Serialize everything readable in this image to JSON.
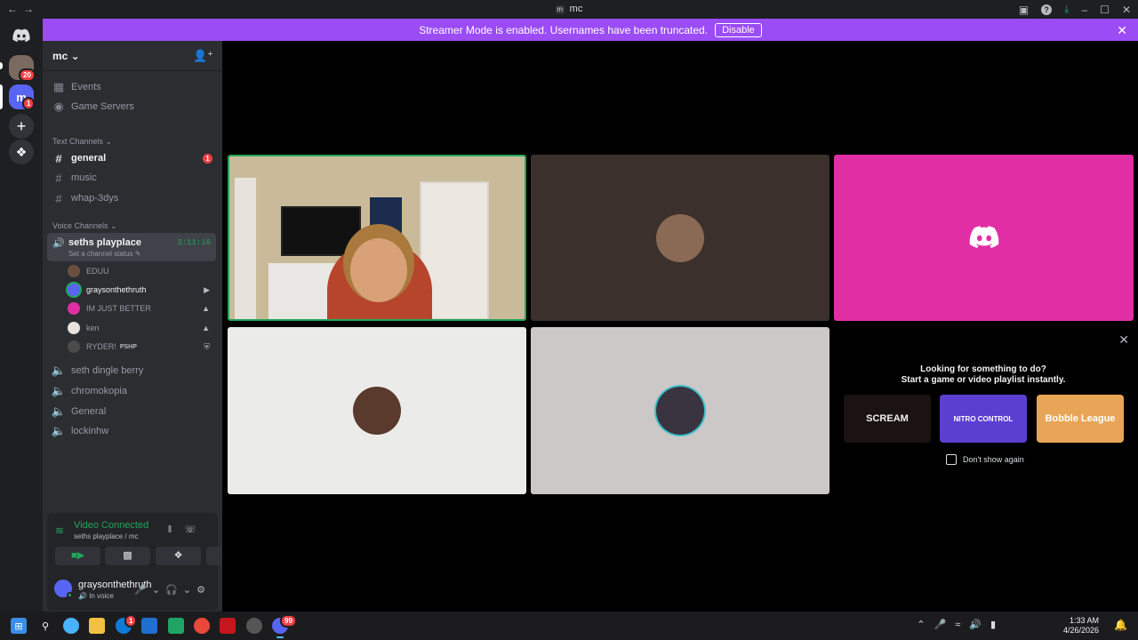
{
  "titlebar": {
    "title": "mc",
    "server_glyph": "m"
  },
  "banner": {
    "message": "Streamer Mode is enabled. Usernames have been truncated.",
    "button": "Disable"
  },
  "rail": {
    "badge1": "20",
    "badge2": "1",
    "srv2_label": "m"
  },
  "sidebar": {
    "server_name": "mc",
    "items": [
      {
        "label": "Events",
        "icon": "calendar-icon"
      },
      {
        "label": "Game Servers",
        "icon": "gamepad-icon"
      }
    ],
    "text_category": "Text Channels",
    "text_channels": [
      {
        "label": "general",
        "unread": "1"
      },
      {
        "label": "music"
      },
      {
        "label": "whap-3dys"
      }
    ],
    "voice_category": "Voice Channels",
    "active_voice": {
      "name": "seths playplace",
      "time": "3:11:16",
      "status": "Set a channel status"
    },
    "users": [
      {
        "name": "EDUU"
      },
      {
        "name": "graysonthethruth"
      },
      {
        "name": "IM JUST BETTER"
      },
      {
        "name": "ken"
      },
      {
        "name": "RYDER!",
        "tag": "PSHP"
      }
    ],
    "voice_channels": [
      {
        "label": "seth dingle berry"
      },
      {
        "label": "chromokopia"
      },
      {
        "label": "General"
      },
      {
        "label": "lockinhw"
      }
    ]
  },
  "voice_panel": {
    "status": "Video Connected",
    "location": "seths playplace / mc",
    "username": "graysonthethruth",
    "user_status": "In voice"
  },
  "activity": {
    "line1": "Looking for something to do?",
    "line2": "Start a game or video playlist instantly.",
    "games": [
      {
        "title": "SCREAM"
      },
      {
        "title": "NITRO CONTROL"
      },
      {
        "title": "Bobble League"
      }
    ],
    "dont_show": "Don't show again"
  },
  "taskbar": {
    "time": "1:33 AM",
    "date": "4/26/2026",
    "badge": "1",
    "discord_badge": "99"
  },
  "colors": {
    "accent": "#5865f2",
    "banner": "#9b4cf5",
    "online": "#23a55a",
    "danger": "#f23f43",
    "tile_pink": "#e12ea5"
  }
}
